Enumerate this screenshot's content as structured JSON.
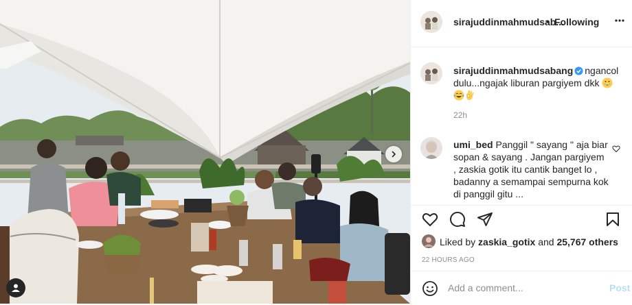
{
  "header": {
    "username": "sirajuddinmahmudsab...",
    "separator": "•",
    "follow_status": "Following"
  },
  "caption": {
    "username": "sirajuddinmahmudsabang",
    "text": "ngancol dulu...ngajak liburan pargiyem dkk",
    "emojis": [
      "grinning-face-icon",
      "tears-of-joy-icon",
      "ok-hand-icon"
    ],
    "time": "22h"
  },
  "comments": [
    {
      "username": "umi_bed",
      "text": "Panggil \" sayang \" aja biar sopan & sayang . Jangan pargiyem , zaskia gotik itu cantik banget lo , badanny a semampai sempurna kok di panggil gitu ..."
    }
  ],
  "actions": {
    "icons": [
      "heart-icon",
      "comment-icon",
      "share-icon",
      "bookmark-icon"
    ]
  },
  "likes": {
    "prefix": "Liked by ",
    "user": "zaskia_gotix",
    "middle": " and ",
    "count": "25,767 others"
  },
  "post_time": "22 HOURS AGO",
  "add_comment": {
    "placeholder": "Add a comment...",
    "post_label": "Post"
  },
  "colors": {
    "link_blue": "#0095f6",
    "post_disabled": "#b2dffc",
    "muted": "#8e8e8e",
    "text": "#262626",
    "border": "#efefef"
  }
}
